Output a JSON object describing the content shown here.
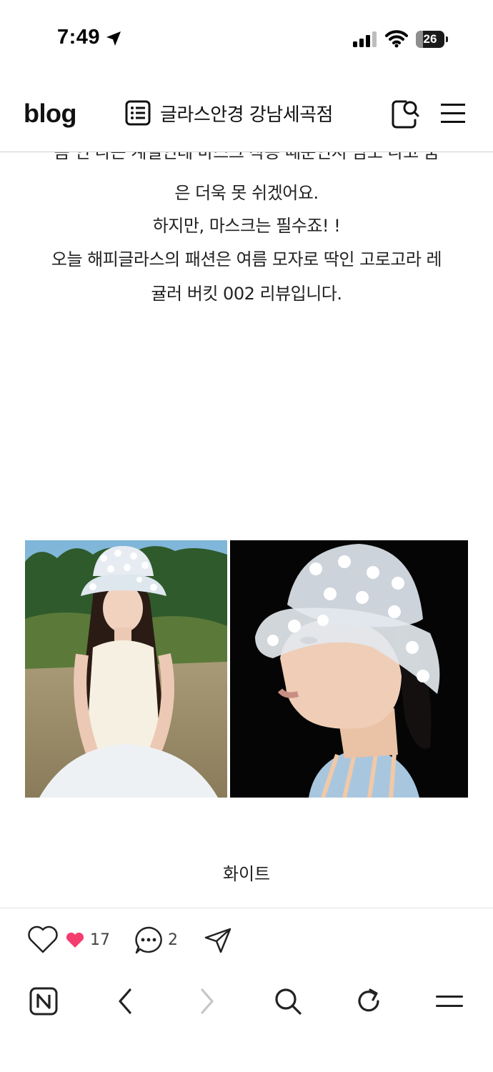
{
  "status_bar": {
    "time": "7:49",
    "battery_level": "26",
    "battery_fraction": 0.26,
    "icons": [
      "location-arrow-icon",
      "signal-icon",
      "wifi-icon",
      "battery-icon"
    ]
  },
  "header": {
    "logo": "blog",
    "title": "글라스안경 강남세곡점",
    "icons": [
      "list-icon",
      "search-user-icon",
      "menu-icon"
    ]
  },
  "article": {
    "cut_line": "봄 인 나는 계절인데 마스크 착용 때문인지 땀도 나고 숨",
    "lines": [
      "은 더욱 못 쉬겠어요.",
      "하지만, 마스크는 필수죠! !",
      "오늘 해피글라스의 패션은 여름 모자로 딱인 고로고라 레",
      "귤러 버킷 002 리뷰입니다."
    ],
    "caption": "화이트"
  },
  "actions": {
    "like_count": "17",
    "comment_count": "2",
    "accent_color": "#f43d6f"
  },
  "browser_nav": {
    "items": [
      "naver-home-icon",
      "back-icon",
      "forward-icon",
      "search-icon",
      "refresh-icon",
      "menu-icon"
    ]
  }
}
